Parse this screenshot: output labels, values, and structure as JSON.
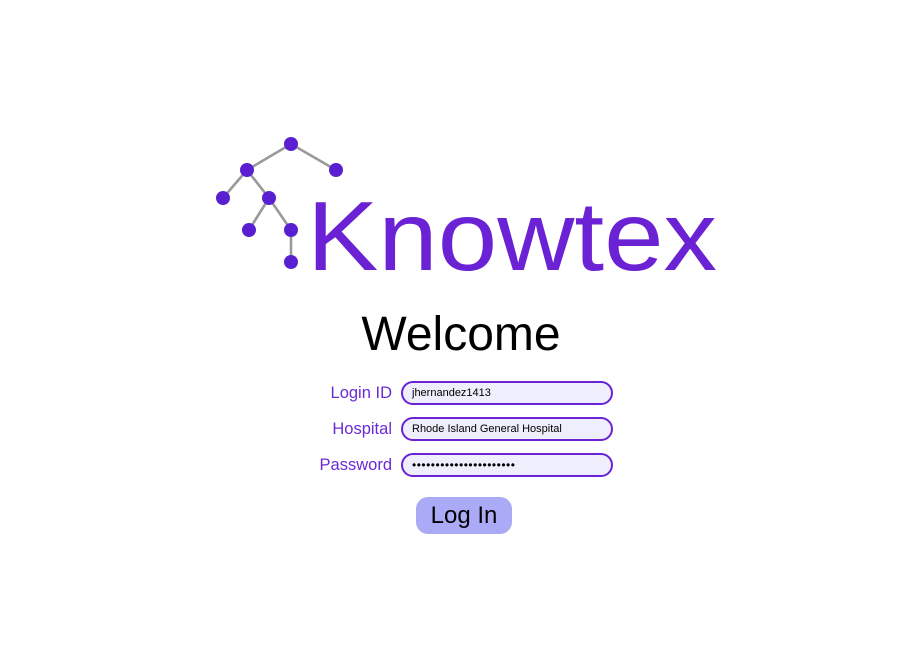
{
  "logo": {
    "wordmark": "Knowtex",
    "icon": "knowledge-tree-icon",
    "colors": {
      "wordmark": "#6a22d4",
      "node": "#5a1fd0",
      "edge": "#9a9a9a"
    }
  },
  "welcome": {
    "title": "Welcome"
  },
  "form": {
    "login_id": {
      "label": "Login ID",
      "value": "jhernandez1413"
    },
    "hospital": {
      "label": "Hospital",
      "value": "Rhode Island General Hospital"
    },
    "password": {
      "label": "Password",
      "value": "••••••••••••••••••••••"
    }
  },
  "login_button": {
    "label": "Log In"
  },
  "colors": {
    "accent": "#6a22d4",
    "label_text": "#6a2bd6",
    "input_fill": "#eeeefc",
    "button_fill": "#aaaaf6"
  }
}
